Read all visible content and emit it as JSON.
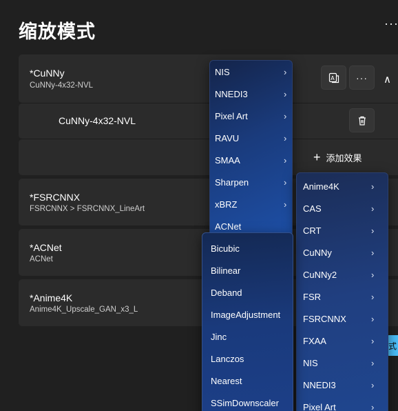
{
  "page": {
    "title": "缩放模式",
    "more_label": "···"
  },
  "cards": [
    {
      "title": "*CuNNy",
      "subtitle": "CuNNy-4x32-NVL"
    },
    {
      "title": "*FSRCNNX",
      "subtitle": "FSRCNNX > FSRCNNX_LineArt"
    },
    {
      "title": "*ACNet",
      "subtitle": "ACNet"
    },
    {
      "title": "*Anime4K",
      "subtitle": "Anime4K_Upscale_GAN_x3_L"
    }
  ],
  "expanded": {
    "effect_label": "CuNNy-4x32-NVL",
    "add_effect_label": "添加效果",
    "more_label": "···",
    "collapse_label": "∧"
  },
  "menu_a": [
    {
      "label": "NIS",
      "arrow": "›"
    },
    {
      "label": "NNEDI3",
      "arrow": "›"
    },
    {
      "label": "Pixel Art",
      "arrow": "›"
    },
    {
      "label": "RAVU",
      "arrow": "›"
    },
    {
      "label": "SMAA",
      "arrow": "›"
    },
    {
      "label": "Sharpen",
      "arrow": "›"
    },
    {
      "label": "xBRZ",
      "arrow": "›"
    },
    {
      "label": "ACNet",
      "arrow": ""
    }
  ],
  "menu_b": [
    {
      "label": "Bicubic"
    },
    {
      "label": "Bilinear"
    },
    {
      "label": "Deband"
    },
    {
      "label": "ImageAdjustment"
    },
    {
      "label": "Jinc"
    },
    {
      "label": "Lanczos"
    },
    {
      "label": "Nearest"
    },
    {
      "label": "SSimDownscaler"
    }
  ],
  "menu_c": [
    {
      "label": "Anime4K",
      "arrow": "›"
    },
    {
      "label": "CAS",
      "arrow": "›"
    },
    {
      "label": "CRT",
      "arrow": "›"
    },
    {
      "label": "CuNNy",
      "arrow": "›"
    },
    {
      "label": "CuNNy2",
      "arrow": "›"
    },
    {
      "label": "FSR",
      "arrow": "›"
    },
    {
      "label": "FSRCNNX",
      "arrow": "›"
    },
    {
      "label": "FXAA",
      "arrow": "›"
    },
    {
      "label": "NIS",
      "arrow": "›"
    },
    {
      "label": "NNEDI3",
      "arrow": "›"
    },
    {
      "label": "Pixel Art",
      "arrow": "›"
    }
  ],
  "partial": {
    "edge_text": "式"
  },
  "colors": {
    "accent": "#4cc2ff",
    "menu_blue": "#1d4fa6",
    "card_bg": "#2b2b2b",
    "page_bg": "#202020"
  }
}
